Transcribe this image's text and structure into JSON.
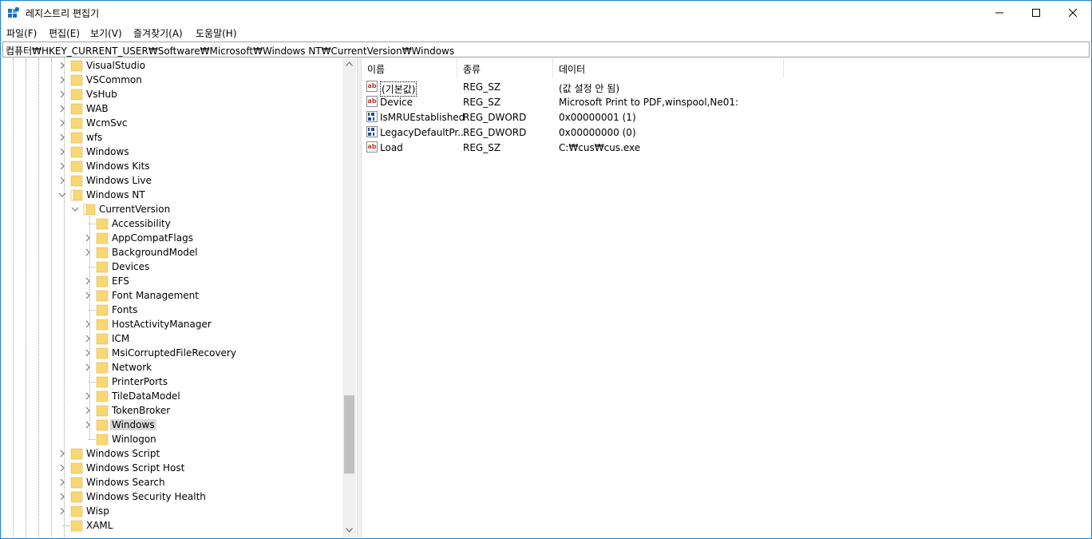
{
  "window": {
    "title": "레지스트리 편집기"
  },
  "menu": [
    "파일(F)",
    "편집(E)",
    "보기(V)",
    "즐겨찾기(A)",
    "도움말(H)"
  ],
  "address": "컴퓨터₩HKEY_CURRENT_USER₩Software₩Microsoft₩Windows NT₩CurrentVersion₩Windows",
  "tree": {
    "top_level": [
      {
        "label": "VisualStudio",
        "expandable": true
      },
      {
        "label": "VSCommon",
        "expandable": true
      },
      {
        "label": "VsHub",
        "expandable": true
      },
      {
        "label": "WAB",
        "expandable": true
      },
      {
        "label": "WcmSvc",
        "expandable": true
      },
      {
        "label": "wfs",
        "expandable": true
      },
      {
        "label": "Windows",
        "expandable": true
      },
      {
        "label": "Windows Kits",
        "expandable": true
      },
      {
        "label": "Windows Live",
        "expandable": true
      },
      {
        "label": "Windows NT",
        "expandable": true,
        "expanded": true
      }
    ],
    "current_version": {
      "label": "CurrentVersion",
      "expanded": true
    },
    "children": [
      {
        "label": "Accessibility",
        "expandable": false
      },
      {
        "label": "AppCompatFlags",
        "expandable": true
      },
      {
        "label": "BackgroundModel",
        "expandable": true
      },
      {
        "label": "Devices",
        "expandable": false
      },
      {
        "label": "EFS",
        "expandable": true
      },
      {
        "label": "Font Management",
        "expandable": true
      },
      {
        "label": "Fonts",
        "expandable": false
      },
      {
        "label": "HostActivityManager",
        "expandable": true
      },
      {
        "label": "ICM",
        "expandable": true
      },
      {
        "label": "MsiCorruptedFileRecovery",
        "expandable": true
      },
      {
        "label": "Network",
        "expandable": true
      },
      {
        "label": "PrinterPorts",
        "expandable": false
      },
      {
        "label": "TileDataModel",
        "expandable": true
      },
      {
        "label": "TokenBroker",
        "expandable": true
      },
      {
        "label": "Windows",
        "expandable": true,
        "selected": true
      },
      {
        "label": "Winlogon",
        "expandable": false
      }
    ],
    "bottom_level": [
      {
        "label": "Windows Script",
        "expandable": true
      },
      {
        "label": "Windows Script Host",
        "expandable": true
      },
      {
        "label": "Windows Search",
        "expandable": true
      },
      {
        "label": "Windows Security Health",
        "expandable": true
      },
      {
        "label": "Wisp",
        "expandable": true
      },
      {
        "label": "XAML",
        "expandable": false
      }
    ]
  },
  "list": {
    "columns": [
      "이름",
      "종류",
      "데이터"
    ],
    "rows": [
      {
        "icon": "string-value-icon",
        "name": "(기본값)",
        "type": "REG_SZ",
        "data": "(값 설정 안 됨)"
      },
      {
        "icon": "string-value-icon",
        "name": "Device",
        "type": "REG_SZ",
        "data": "Microsoft Print to PDF,winspool,Ne01:"
      },
      {
        "icon": "dword-value-icon",
        "name": "IsMRUEstablished",
        "type": "REG_DWORD",
        "data": "0x00000001 (1)"
      },
      {
        "icon": "dword-value-icon",
        "name": "LegacyDefaultPr...",
        "type": "REG_DWORD",
        "data": "0x00000000 (0)"
      },
      {
        "icon": "string-value-icon",
        "name": "Load",
        "type": "REG_SZ",
        "data": "C:₩cus₩cus.exe"
      }
    ]
  },
  "colors": {
    "border": "#1883d7",
    "folder": "#f8d775",
    "selection": "#d9d9d9"
  }
}
